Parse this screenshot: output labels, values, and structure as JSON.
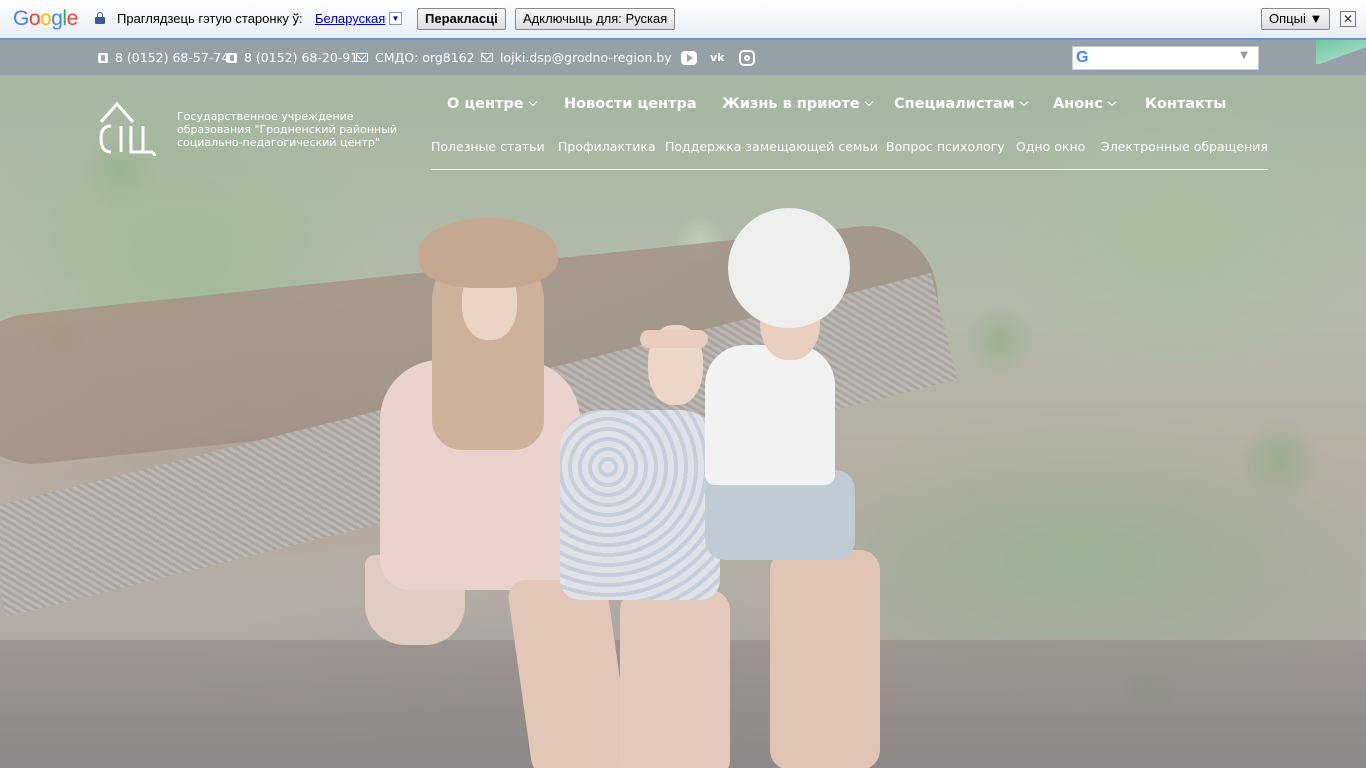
{
  "translate_bar": {
    "logo": "Google",
    "prompt": "Праглядзець гэтую старонку ў:",
    "language": "Беларуская",
    "translate_button": "Перакласці",
    "disable_button": "Адключыць для: Руская",
    "options_button": "Опцыі ▼",
    "close": "✕"
  },
  "info_bar": {
    "phone1": "8 (0152) 68-57-74",
    "phone2": "8 (0152) 68-20-91",
    "smdo": "СМДО: org8162",
    "email": "lojki.dsp@grodno-region.by",
    "socials": [
      "youtube-icon",
      "vk-icon",
      "instagram-icon"
    ],
    "translate_widget": "G"
  },
  "logo": {
    "text": "Государственное учреждение образования \"Гродненский районный социально-педагогический центр\""
  },
  "nav": {
    "main": [
      {
        "label": "О центре",
        "dropdown": true
      },
      {
        "label": "Новости центра",
        "dropdown": false
      },
      {
        "label": "Жизнь в приюте",
        "dropdown": true
      },
      {
        "label": "Специалистам",
        "dropdown": true
      },
      {
        "label": "Анонс",
        "dropdown": true
      },
      {
        "label": "Контакты",
        "dropdown": false
      }
    ],
    "sub": [
      "Полезные статьи",
      "Профилактика",
      "Поддержка замещающей семьи",
      "Вопрос психологу",
      "Одно окно",
      "Электронные обращения"
    ]
  },
  "colors": {
    "info_bar": "#96a0a8",
    "accent_tab": "#6fc6a0",
    "link": "#0000cc"
  }
}
